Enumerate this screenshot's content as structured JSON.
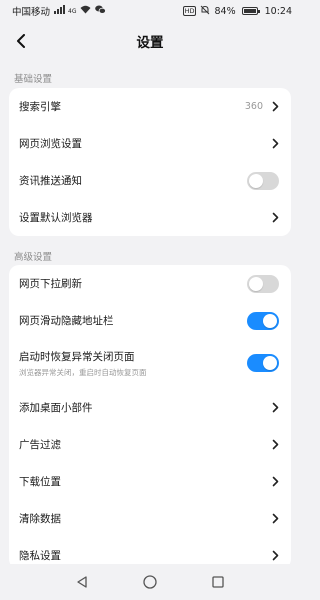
{
  "status_bar": {
    "carrier": "中国移动",
    "network": "4G",
    "hd": "HD",
    "battery": "84%",
    "battery_level": 0.84,
    "time": "10:24"
  },
  "header": {
    "title": "设置",
    "back_icon": "back-arrow-icon"
  },
  "sections": [
    {
      "label": "基础设置",
      "items": [
        {
          "label": "搜索引擎",
          "value": "360",
          "control": "chevron"
        },
        {
          "label": "网页浏览设置",
          "control": "chevron"
        },
        {
          "label": "资讯推送通知",
          "control": "toggle",
          "on": false
        },
        {
          "label": "设置默认浏览器",
          "control": "chevron"
        }
      ]
    },
    {
      "label": "高级设置",
      "items": [
        {
          "label": "网页下拉刷新",
          "control": "toggle",
          "on": false
        },
        {
          "label": "网页滑动隐藏地址栏",
          "control": "toggle",
          "on": true
        },
        {
          "label": "启动时恢复异常关闭页面",
          "sublabel": "浏览器异常关闭，重启时自动恢复页面",
          "control": "toggle",
          "on": true
        },
        {
          "label": "添加桌面小部件",
          "control": "chevron"
        },
        {
          "label": "广告过滤",
          "control": "chevron"
        },
        {
          "label": "下载位置",
          "control": "chevron"
        },
        {
          "label": "清除数据",
          "control": "chevron"
        },
        {
          "label": "隐私设置",
          "control": "chevron"
        }
      ]
    }
  ],
  "colors": {
    "accent": "#1a8cff",
    "toggle_off": "#d8d8d8",
    "background": "#f2f2f4"
  },
  "nav_bar": {
    "icons": [
      "back-triangle-icon",
      "home-circle-icon",
      "recents-square-icon"
    ]
  }
}
